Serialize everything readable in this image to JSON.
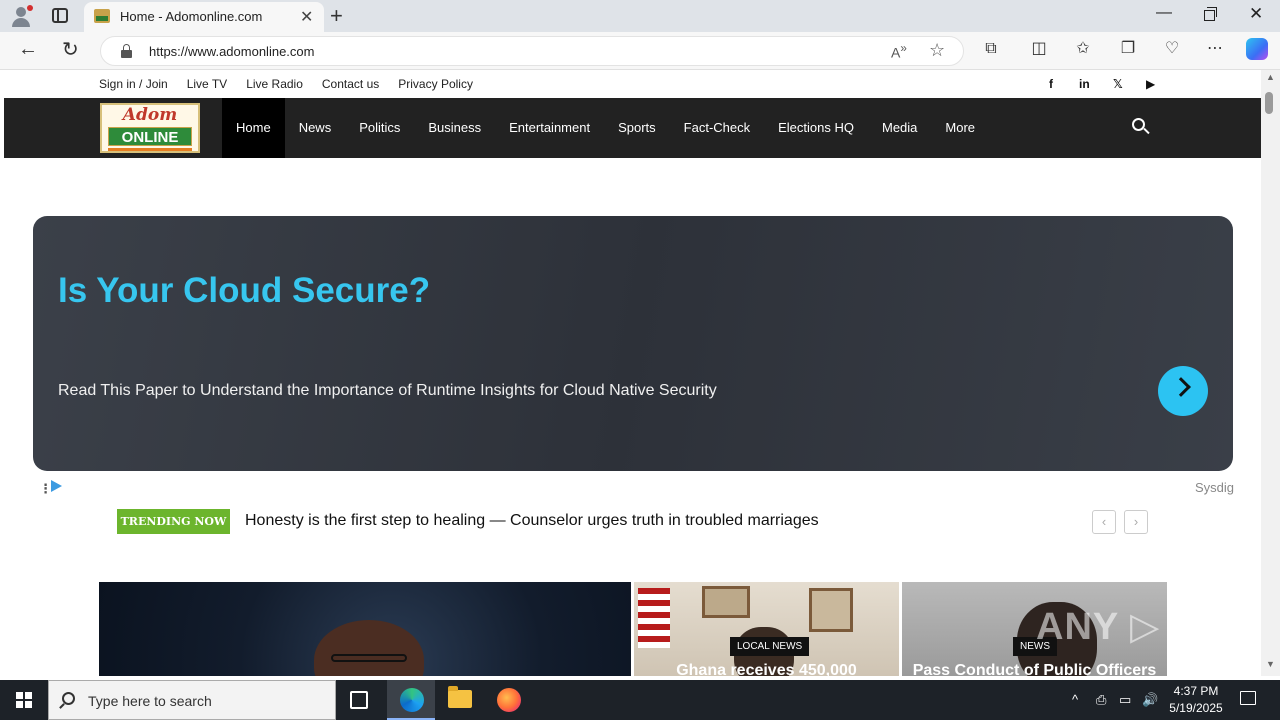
{
  "browser": {
    "tab_title": "Home - Adomonline.com",
    "url": "https://www.adomonline.com",
    "icons": [
      "profile-icon",
      "tab-actions-icon",
      "close-icon",
      "new-tab-icon",
      "back-icon",
      "reload-icon",
      "lock-icon",
      "read-aloud-icon",
      "favorite-icon",
      "extensions-icon",
      "split-screen-icon",
      "favorites-icon",
      "collections-icon",
      "browser-essentials-icon",
      "more-icon",
      "copilot-icon"
    ]
  },
  "site": {
    "top_links": [
      "Sign in / Join",
      "Live TV",
      "Live Radio",
      "Contact us",
      "Privacy Policy"
    ],
    "social_icons": [
      "facebook-icon",
      "linkedin-icon",
      "x-icon",
      "youtube-icon"
    ],
    "social_glyphs": [
      "f",
      "in",
      "𝕏",
      "▶"
    ],
    "logo": {
      "top": "Adom",
      "bottom": "ONLINE"
    },
    "nav": [
      "Home",
      "News",
      "Politics",
      "Business",
      "Entertainment",
      "Sports",
      "Fact-Check",
      "Elections HQ",
      "Media",
      "More"
    ],
    "active_nav": "Home"
  },
  "ad": {
    "title": "Is Your Cloud Secure?",
    "body": "Read This Paper to Understand the Importance of Runtime Insights for Cloud Native Security",
    "sponsor": "Sysdig",
    "menu_glyph": "⋮"
  },
  "trending": {
    "label": "TRENDING NOW",
    "headline": "Honesty is the first step to healing — Counselor urges truth in troubled marriages",
    "prev": "‹",
    "next": "›"
  },
  "cards": [
    {
      "badge": "",
      "title": ""
    },
    {
      "badge": "LOCAL NEWS",
      "title": "Ghana receives 450,000"
    },
    {
      "badge": "NEWS",
      "title": "Pass Conduct of Public Officers"
    }
  ],
  "watermark": "ANY ▷ RUN",
  "taskbar": {
    "search_placeholder": "Type here to search",
    "time": "4:37 PM",
    "date": "5/19/2025",
    "tray_icons": [
      "chevron-up-icon",
      "meet-now-icon",
      "network-icon",
      "volume-icon"
    ],
    "tray_glyphs": [
      "^",
      "⎙",
      "▭",
      "🔊"
    ]
  },
  "colors": {
    "nav_bg": "#222222",
    "trending_green": "#6cb52d",
    "ad_accent": "#37c6ef"
  }
}
